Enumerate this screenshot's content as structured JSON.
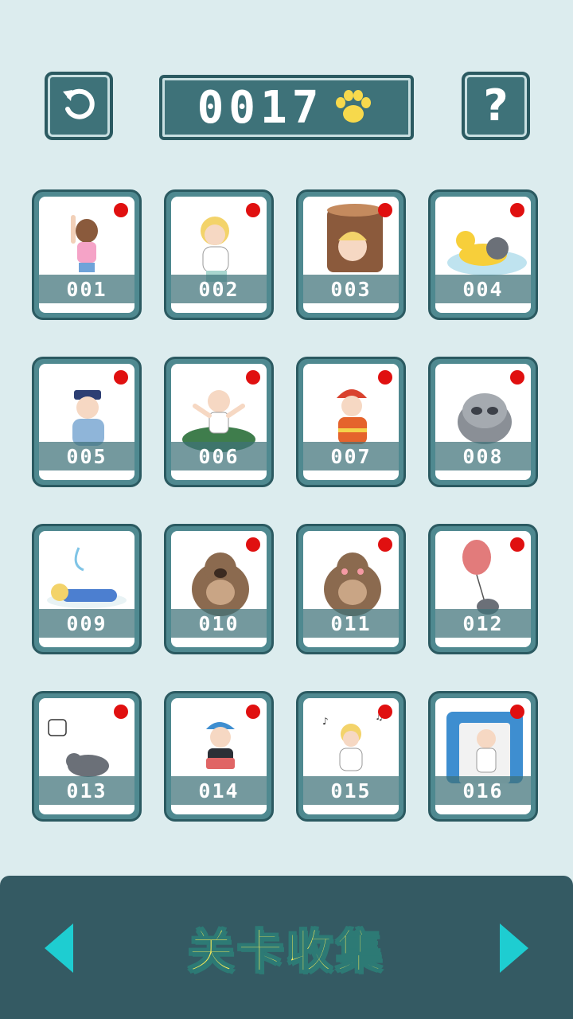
{
  "header": {
    "undo_icon": "undo-arrow-icon",
    "counter_value": "0017",
    "counter_icon": "paw-icon",
    "help_label": "?"
  },
  "levels": [
    {
      "number": "001",
      "art": "girl-at-wall",
      "new_badge": true
    },
    {
      "number": "002",
      "art": "angry-blonde-man",
      "new_badge": true
    },
    {
      "number": "003",
      "art": "man-in-tree-stump",
      "new_badge": true
    },
    {
      "number": "004",
      "art": "cat-in-duck-float",
      "new_badge": true
    },
    {
      "number": "005",
      "art": "police-officer",
      "new_badge": true
    },
    {
      "number": "006",
      "art": "man-in-bush",
      "new_badge": true
    },
    {
      "number": "007",
      "art": "firefighter",
      "new_badge": true
    },
    {
      "number": "008",
      "art": "raccoon",
      "new_badge": true
    },
    {
      "number": "009",
      "art": "man-lying-down",
      "new_badge": false
    },
    {
      "number": "010",
      "art": "bear",
      "new_badge": true
    },
    {
      "number": "011",
      "art": "bear-blushing",
      "new_badge": true
    },
    {
      "number": "012",
      "art": "cat-with-balloon",
      "new_badge": true
    },
    {
      "number": "013",
      "art": "cat-on-back",
      "new_badge": true
    },
    {
      "number": "014",
      "art": "boy-with-basket",
      "new_badge": true
    },
    {
      "number": "015",
      "art": "singing-man",
      "new_badge": true
    },
    {
      "number": "016",
      "art": "boy-in-train-door",
      "new_badge": true
    }
  ],
  "footer": {
    "title": "关卡收集",
    "prev_icon": "triangle-left-icon",
    "next_icon": "triangle-right-icon"
  },
  "colors": {
    "background": "#dcecee",
    "panel": "#3e7279",
    "bottom_bar": "#345a63",
    "badge": "#e01010",
    "arrow": "#1ecdd1",
    "title_text": "#f6e95a"
  }
}
